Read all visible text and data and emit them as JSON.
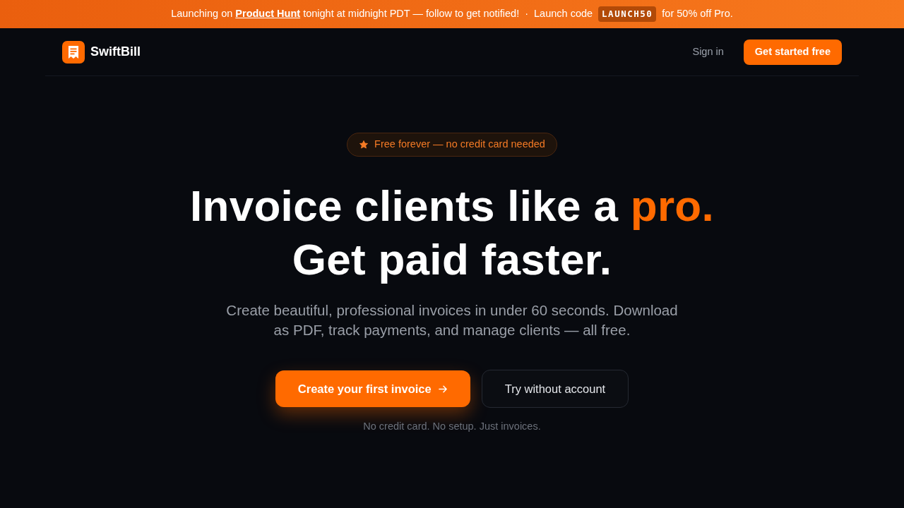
{
  "announcement_bar": {
    "message": {
      "before_link": "Launching on ",
      "link": "Product Hunt",
      "after_link": " tonight at midnight PDT — follow to get notified!"
    },
    "separator": "·",
    "promo_label": "Launch code",
    "promo_code": "LAUNCH50",
    "promo_suffix": "for 50% off Pro."
  },
  "navbar": {
    "brand": "SwiftBill",
    "links": [
      {
        "label": "Sign in",
        "kind": "link"
      },
      {
        "label": "Get started free",
        "kind": "button"
      }
    ]
  },
  "hero": {
    "badge": "Free forever — no credit card needed",
    "headline": {
      "lines": [
        {
          "segments": [
            {
              "text": "Invoice clients like a ",
              "highlight": false
            },
            {
              "text": "pro.",
              "highlight": true
            }
          ]
        },
        {
          "segments": [
            {
              "text": "Get paid faster.",
              "highlight": false
            }
          ]
        }
      ]
    },
    "subtitle": "Create beautiful, professional invoices in under 60 seconds. Download as PDF, track payments, and manage clients — all free.",
    "actions": [
      {
        "label": "Create your first invoice",
        "kind": "primary"
      },
      {
        "label": "Try without account",
        "kind": "secondary"
      }
    ],
    "note": "No credit card. No setup. Just invoices."
  }
}
